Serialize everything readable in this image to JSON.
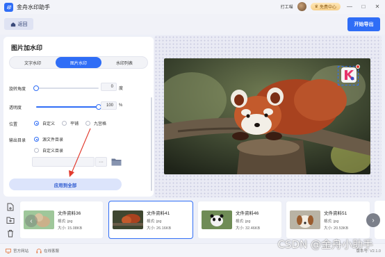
{
  "app": {
    "title": "金舟水印助手",
    "username": "打工喵",
    "vip_label": "免费中心",
    "window_controls": [
      "minimize-icon",
      "maximize-icon",
      "close-icon"
    ]
  },
  "header": {
    "back_label": "返回",
    "export_label": "开始导出"
  },
  "panel": {
    "title": "图片加水印",
    "tabs": [
      {
        "label": "文字水印",
        "active": false
      },
      {
        "label": "图片水印",
        "active": true
      },
      {
        "label": "水印列表",
        "active": false
      }
    ],
    "rotation": {
      "label": "旋转角度",
      "value": "0",
      "unit": "度",
      "fraction": 0
    },
    "opacity": {
      "label": "透明度",
      "value": "100",
      "unit": "%",
      "fraction": 1.0
    },
    "position": {
      "label": "位置",
      "options": [
        {
          "label": "自定义",
          "selected": true
        },
        {
          "label": "平铺",
          "selected": false
        },
        {
          "label": "九宫格",
          "selected": false
        }
      ]
    },
    "output": {
      "label": "输出目录",
      "options": [
        {
          "label": "源文件目录",
          "selected": true
        },
        {
          "label": "自定义目录",
          "selected": false
        }
      ],
      "path_value": "",
      "browse_label": "···"
    },
    "apply_label": "应用到全部"
  },
  "files": [
    {
      "name": "文件资料36",
      "format": "格式: jpg",
      "size": "大小: 15.08KB",
      "selected": false,
      "thumb": "cat"
    },
    {
      "name": "文件资料41",
      "format": "格式: jpg",
      "size": "大小: 26.16KB",
      "selected": true,
      "thumb": "red-panda"
    },
    {
      "name": "文件资料46",
      "format": "格式: jpg",
      "size": "大小: 32.46KB",
      "selected": false,
      "thumb": "panda"
    },
    {
      "name": "文件资料51",
      "format": "格式: jpg",
      "size": "大小: 20.53KB",
      "selected": false,
      "thumb": "dog"
    }
  ],
  "footer": {
    "website_label": "官方网站",
    "service_label": "在线客服",
    "version": "版本号: V2.1.0"
  },
  "watermark_text": "CSDN @金舟小助手",
  "colors": {
    "accent": "#2f6df6",
    "panel_bg": "#ffffff",
    "app_bg": "#eef0f8"
  }
}
